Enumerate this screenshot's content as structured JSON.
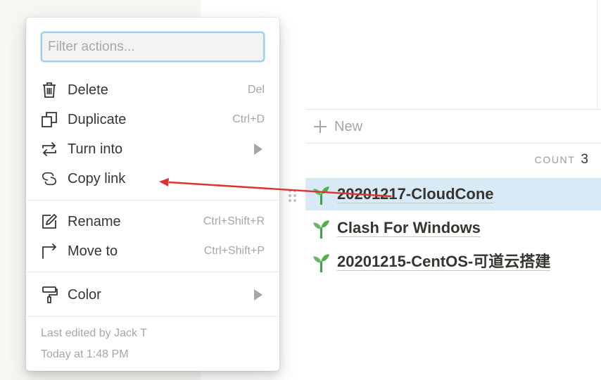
{
  "menu": {
    "filter_placeholder": "Filter actions...",
    "items": [
      {
        "icon": "trash-icon",
        "label": "Delete",
        "shortcut": "Del"
      },
      {
        "icon": "duplicate-icon",
        "label": "Duplicate",
        "shortcut": "Ctrl+D"
      },
      {
        "icon": "turn-into-icon",
        "label": "Turn into",
        "submenu": true
      },
      {
        "icon": "link-icon",
        "label": "Copy link"
      },
      {
        "icon": "pencil-icon",
        "label": "Rename",
        "shortcut": "Ctrl+Shift+R"
      },
      {
        "icon": "move-arrow-icon",
        "label": "Move to",
        "shortcut": "Ctrl+Shift+P"
      },
      {
        "icon": "paint-roller-icon",
        "label": "Color",
        "submenu": true
      }
    ],
    "last_edited": "Last edited by Jack T",
    "edited_time": "Today at 1:48 PM"
  },
  "board": {
    "new_label": "New",
    "count_label": "COUNT",
    "count_value": "3",
    "pages": [
      {
        "icon": "sprout-icon",
        "title": "20201217-CloudCone",
        "selected": true
      },
      {
        "icon": "sprout-icon",
        "title": "Clash For Windows",
        "selected": false
      },
      {
        "icon": "sprout-icon",
        "title": "20201215-CentOS-可道云搭建",
        "selected": false
      }
    ]
  },
  "colors": {
    "selected_row": "#d7eaf5",
    "annotation_arrow": "#e03131",
    "focus_ring": "#9fcdec",
    "sprout": "#4caf50"
  }
}
